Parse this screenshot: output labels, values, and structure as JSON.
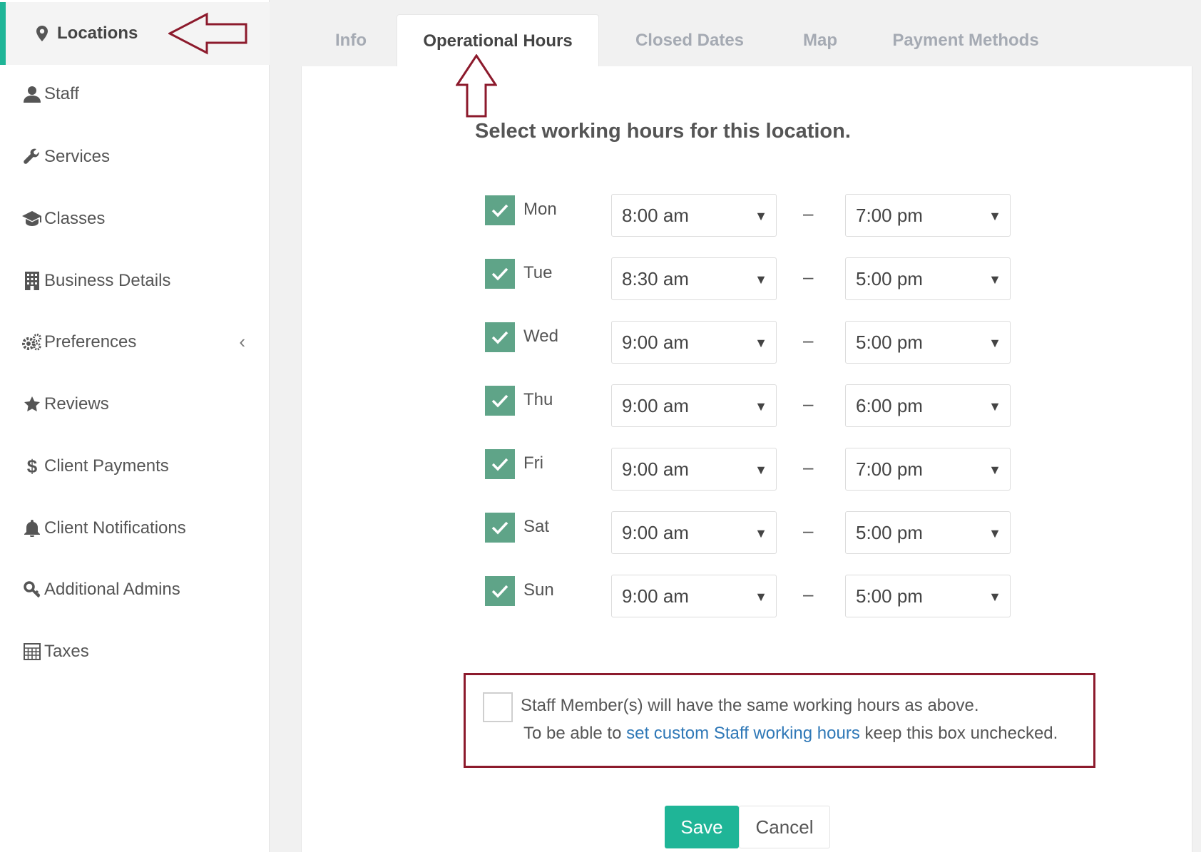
{
  "sidebar": {
    "items": [
      {
        "label": "Locations",
        "icon": "map-pin-icon"
      },
      {
        "label": "Staff",
        "icon": "user-icon"
      },
      {
        "label": "Services",
        "icon": "wrench-icon"
      },
      {
        "label": "Classes",
        "icon": "graduation-cap-icon"
      },
      {
        "label": "Business Details",
        "icon": "building-icon"
      },
      {
        "label": "Preferences",
        "icon": "gears-icon"
      },
      {
        "label": "Reviews",
        "icon": "star-icon"
      },
      {
        "label": "Client Payments",
        "icon": "dollar-icon"
      },
      {
        "label": "Client Notifications",
        "icon": "bell-icon"
      },
      {
        "label": "Additional Admins",
        "icon": "key-icon"
      },
      {
        "label": "Taxes",
        "icon": "calculator-icon"
      }
    ],
    "preferences_chevron": "‹"
  },
  "tabs": [
    {
      "label": "Info"
    },
    {
      "label": "Operational Hours"
    },
    {
      "label": "Closed Dates"
    },
    {
      "label": "Map"
    },
    {
      "label": "Payment Methods"
    }
  ],
  "main": {
    "heading": "Select working hours for this location.",
    "dash": "–",
    "caret": "▼",
    "days": [
      {
        "day": "Mon",
        "start": "8:00 am",
        "end": "7:00 pm"
      },
      {
        "day": "Tue",
        "start": "8:30 am",
        "end": "5:00 pm"
      },
      {
        "day": "Wed",
        "start": "9:00 am",
        "end": "5:00 pm"
      },
      {
        "day": "Thu",
        "start": "9:00 am",
        "end": "6:00 pm"
      },
      {
        "day": "Fri",
        "start": "9:00 am",
        "end": "7:00 pm"
      },
      {
        "day": "Sat",
        "start": "9:00 am",
        "end": "5:00 pm"
      },
      {
        "day": "Sun",
        "start": "9:00 am",
        "end": "5:00 pm"
      }
    ],
    "staff": {
      "line1": "Staff Member(s) will have the same working hours as above.",
      "line2_pre": "To be able to ",
      "line2_link": "set custom Staff working hours",
      "line2_post": " keep this box unchecked."
    },
    "save_label": "Save",
    "cancel_label": "Cancel"
  },
  "colors": {
    "accent": "#1fb597",
    "checkbox": "#5fa488",
    "annotation": "#8c1a2c",
    "link": "#2f78b7"
  }
}
